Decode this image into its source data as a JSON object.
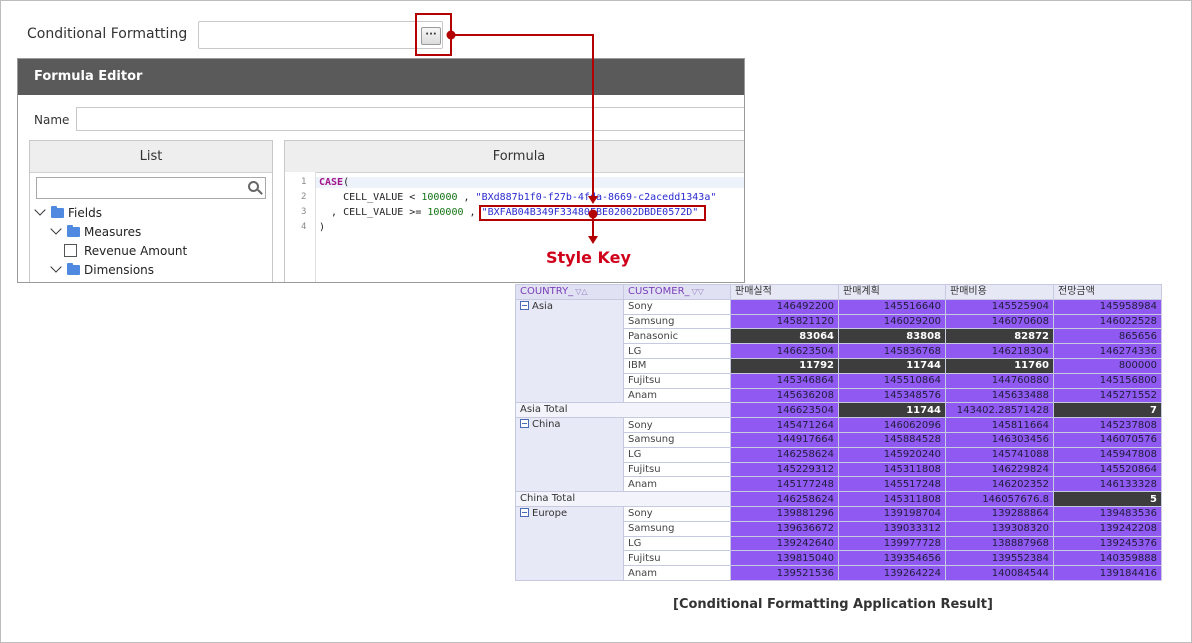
{
  "conditional_formatting": {
    "label": "Conditional Formatting",
    "button_label": "···"
  },
  "formula_editor": {
    "title": "Formula Editor",
    "name_label": "Name",
    "name_value": "",
    "list_header": "List",
    "formula_header": "Formula",
    "search_value": "",
    "tree": [
      {
        "label": "Fields",
        "type": "folder"
      },
      {
        "label": "Measures",
        "type": "folder"
      },
      {
        "label": "Revenue Amount",
        "type": "checkbox"
      },
      {
        "label": "Dimensions",
        "type": "folder"
      }
    ],
    "line_numbers": [
      "1",
      "2",
      "3",
      "4"
    ],
    "code": {
      "l1_kw": "CASE",
      "l1_rest": "(",
      "l2_a": "    CELL_VALUE < ",
      "l2_num": "100000",
      "l2_b": " , ",
      "l2_str": "\"BXd887b1f0-f27b-4fda-8669-c2acedd1343a\"",
      "l3_a": "  , CELL_VALUE >= ",
      "l3_num": "100000",
      "l3_b": " , ",
      "l3_str": "\"BXFAB04B349F33480FBE02002DBDE0572D\"",
      "l4": ")"
    }
  },
  "annotation": {
    "style_key": "Style Key"
  },
  "pivot": {
    "headers": {
      "country": "COUNTRY_",
      "customer": "CUSTOMER_",
      "m1": "판매실적",
      "m2": "판매계획",
      "m3": "판매비용",
      "m4": "전망금액"
    },
    "groups": {
      "asia": "Asia",
      "asia_total": "Asia Total",
      "china": "China",
      "china_total": "China Total",
      "europe": "Europe"
    },
    "rows": {
      "a1": [
        "Sony",
        "146492200",
        "145516640",
        "145525904",
        "145958984"
      ],
      "a2": [
        "Samsung",
        "145821120",
        "146029200",
        "146070608",
        "146022528"
      ],
      "a3": [
        "Panasonic",
        "83064",
        "83808",
        "82872",
        "865656"
      ],
      "a4": [
        "LG",
        "146623504",
        "145836768",
        "146218304",
        "146274336"
      ],
      "a5": [
        "IBM",
        "11792",
        "11744",
        "11760",
        "800000"
      ],
      "a6": [
        "Fujitsu",
        "145346864",
        "145510864",
        "144760880",
        "145156800"
      ],
      "a7": [
        "Anam",
        "145636208",
        "145348576",
        "145633488",
        "145271552"
      ],
      "at": [
        "",
        "146623504",
        "11744",
        "143402.28571428",
        "7"
      ],
      "c1": [
        "Sony",
        "145471264",
        "146062096",
        "145811664",
        "145237808"
      ],
      "c2": [
        "Samsung",
        "144917664",
        "145884528",
        "146303456",
        "146070576"
      ],
      "c3": [
        "LG",
        "146258624",
        "145920240",
        "145741088",
        "145947808"
      ],
      "c4": [
        "Fujitsu",
        "145229312",
        "145311808",
        "146229824",
        "145520864"
      ],
      "c5": [
        "Anam",
        "145177248",
        "145517248",
        "146202352",
        "146133328"
      ],
      "ct": [
        "",
        "146258624",
        "145311808",
        "146057676.8",
        "5"
      ],
      "e1": [
        "Sony",
        "139881296",
        "139198704",
        "139288864",
        "139483536"
      ],
      "e2": [
        "Samsung",
        "139636672",
        "139033312",
        "139308320",
        "139242208"
      ],
      "e3": [
        "LG",
        "139242640",
        "139977728",
        "138887968",
        "139245376"
      ],
      "e4": [
        "Fujitsu",
        "139815040",
        "139354656",
        "139552384",
        "140359888"
      ],
      "e5": [
        "Anam",
        "139521536",
        "139264224",
        "140084544",
        "139184416"
      ]
    }
  },
  "caption": "[Conditional Formatting Application Result]",
  "colors": {
    "accent_red": "#b30000",
    "style_key_red": "#d0021b",
    "cell_purple": "#9059f2",
    "cell_dark": "#3d3d3d"
  }
}
